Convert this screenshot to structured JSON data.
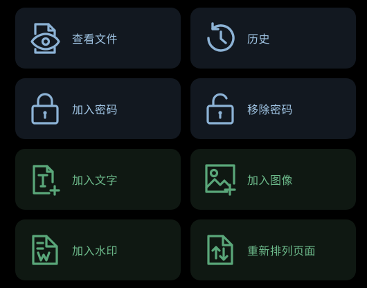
{
  "colors": {
    "background": "#000000",
    "blue_card": "#121820",
    "green_card": "#0f1812",
    "blue_accent": "#8db3d6",
    "green_accent": "#5aa77a"
  },
  "cards": [
    {
      "label": "查看文件",
      "icon": "view-file-icon",
      "theme": "blue"
    },
    {
      "label": "历史",
      "icon": "history-icon",
      "theme": "blue"
    },
    {
      "label": "加入密码",
      "icon": "lock-icon",
      "theme": "blue"
    },
    {
      "label": "移除密码",
      "icon": "unlock-icon",
      "theme": "blue"
    },
    {
      "label": "加入文字",
      "icon": "add-text-icon",
      "theme": "green"
    },
    {
      "label": "加入图像",
      "icon": "add-image-icon",
      "theme": "green"
    },
    {
      "label": "加入水印",
      "icon": "watermark-icon",
      "theme": "green"
    },
    {
      "label": "重新排列页面",
      "icon": "reorder-pages-icon",
      "theme": "green"
    }
  ]
}
